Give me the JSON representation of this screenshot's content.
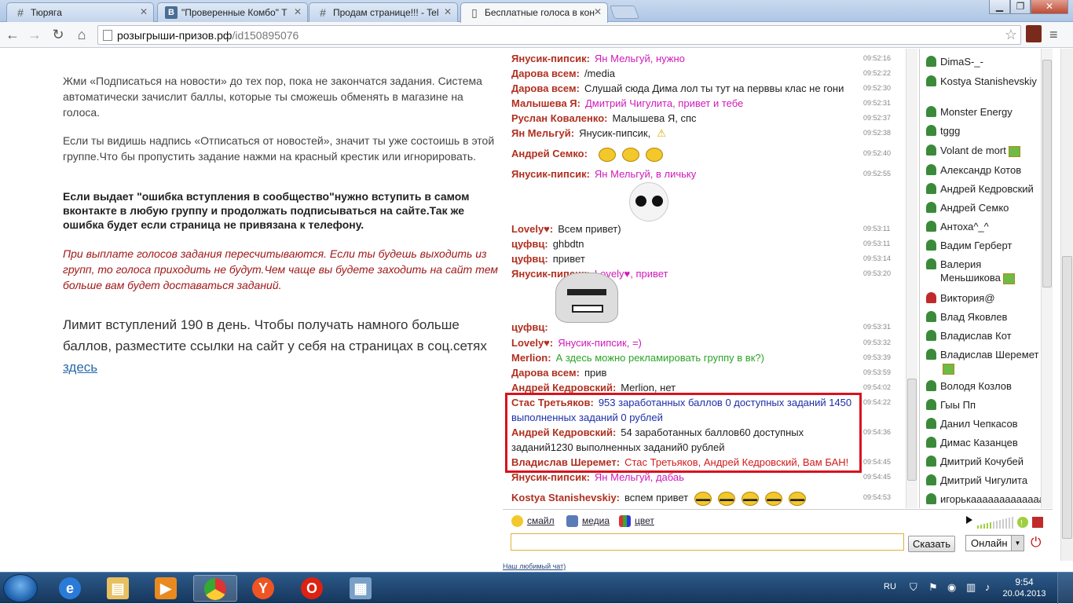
{
  "browser": {
    "tabs": [
      {
        "icon": "#",
        "title": "Тюрягa"
      },
      {
        "icon": "B",
        "title": "\"Проверенные Комбо\" Т"
      },
      {
        "icon": "#",
        "title": "Продам страницe!!! - Tel"
      },
      {
        "icon": "doc",
        "title": "Бесплатные голоса в кон"
      }
    ],
    "url_host": "розыгрыши-призов.рф",
    "url_path": "/id150895076"
  },
  "left": {
    "p1": "Жми «Подписаться на новости» до тех пор, пока не закончатся задания. Система автоматически зачислит баллы, которые ты сможешь обменять в магазине на голоса.",
    "p2": "Если ты видишь надпись «Отписаться от новостей», значит ты уже состоишь в этой группе.Что бы пропустить задание нажми на красный крестик или игнорировать.",
    "p3": "Если выдает \"ошибка вступления в сообщество\"нужно вступить в самом вконтакте в любую группу и продолжать подписываться на сайте.Так же ошибка будет если страница не привязана к телефону.",
    "p4": "При выплате голосов задания пересчитываются. Если ты будешь выходить из групп, то голоса приходить не будут.Чем чаще вы будете заходить на сайт тем больше вам будет доставаться заданий.",
    "p5_text": "Лимит вступлений 190 в день. Чтобы получать намного больше баллов, разместите ссылки на сайт у себя на страницах в соц.сетях ",
    "p5_link": "здесь"
  },
  "chat": {
    "messages": [
      {
        "nick": "Янусик-пипсик:",
        "text": "Ян Мельгуй, нужно",
        "color": "pink",
        "time": "09:52:16"
      },
      {
        "nick": "Дарова всем:",
        "text": "/media",
        "color": "",
        "time": "09:52:22"
      },
      {
        "nick": "Дарова всем:",
        "text": "Слушай сюда Дима лол ты тут на перввы клас не гони",
        "color": "",
        "time": "09:52:30"
      },
      {
        "nick": "Малышева Я:",
        "text": "Дмитрий Чигулита, привет и тебе",
        "color": "pink",
        "time": "09:52:31"
      },
      {
        "nick": "Руслан Коваленко:",
        "text": "Малышева Я, спс",
        "color": "",
        "time": "09:52:37"
      },
      {
        "nick": "Ян Мельгуй:",
        "text": "Янусик-пипсик,",
        "color": "",
        "time": "09:52:38"
      },
      {
        "nick": "Андрей Семко:",
        "text": "",
        "color": "",
        "time": "09:52:40"
      },
      {
        "nick": "Янусик-пипсик:",
        "text": "Ян Мельгуй, в личьку",
        "color": "pink",
        "time": "09:52:55"
      },
      {
        "nick": "Lovely♥:",
        "text": "Всем привет)",
        "color": "",
        "time": "09:53:11"
      },
      {
        "nick": "цуфвц:",
        "text": "ghbdtn",
        "color": "",
        "time": "09:53:11"
      },
      {
        "nick": "цуфвц:",
        "text": "привет",
        "color": "",
        "time": "09:53:14"
      },
      {
        "nick": "Янусик-пипсик:",
        "text": "Lovely♥, привет",
        "color": "pink",
        "time": "09:53:20"
      },
      {
        "nick": "цуфвц:",
        "text": "",
        "color": "",
        "time": "09:53:31"
      },
      {
        "nick": "Lovely♥:",
        "text": "Янусик-пипсик, =)",
        "color": "pink",
        "time": "09:53:32"
      },
      {
        "nick": "Merlion:",
        "text": "А здесь можно рекламировать группу в вк?)",
        "color": "green",
        "time": "09:53:39"
      },
      {
        "nick": "Дарова всем:",
        "text": "прив",
        "color": "",
        "time": "09:53:59"
      },
      {
        "nick": "Андрей Кедровский:",
        "text": "Merlion, нет",
        "color": "",
        "time": "09:54:02"
      },
      {
        "nick": "Стас Третьяков:",
        "text": "953 заработанных баллов 0 доступных заданий 1450 выполненных заданий 0 рублей",
        "color": "blue",
        "time": "09:54:22"
      },
      {
        "nick": "Андрей Кедровский:",
        "text": "54 заработанных баллов60 доступных заданий1230 выполненных заданий0 рублей",
        "color": "",
        "time": "09:54:36"
      },
      {
        "nick": "Владислав Шеремет:",
        "text": "Стас Третьяков, Андрей Кедровский, Вам БАН!",
        "color": "red",
        "time": "09:54:45"
      },
      {
        "nick": "Янусик-пипсик:",
        "text": "Ян Мельгуй, дабаь",
        "color": "pink",
        "time": "09:54:45"
      },
      {
        "nick": "Kostya Stanishevskiy:",
        "text": "вспем привет",
        "color": "",
        "time": "09:54:53"
      }
    ],
    "tools": {
      "smile": "смайл",
      "media": "медиа",
      "color": "цвет"
    },
    "send_label": "Сказать",
    "status_value": "Онлайн",
    "footer": "Наш любимый чат)"
  },
  "users": [
    {
      "name": "DimaS-_-",
      "icon": "green",
      "gift": false
    },
    {
      "name": "Kostya Stanishevskiy",
      "icon": "green",
      "gift": false
    },
    {
      "name": "Monster Energy",
      "icon": "green",
      "gift": false
    },
    {
      "name": "tggg",
      "icon": "green",
      "gift": false
    },
    {
      "name": "Volant de mort",
      "icon": "green",
      "gift": true
    },
    {
      "name": "Александр Котов",
      "icon": "green",
      "gift": false
    },
    {
      "name": "Андрей Кедровский",
      "icon": "green",
      "gift": false
    },
    {
      "name": "Андрей Семко",
      "icon": "green",
      "gift": false
    },
    {
      "name": "Антоха^_^",
      "icon": "green",
      "gift": false
    },
    {
      "name": "Вадим Герберт",
      "icon": "green",
      "gift": false
    },
    {
      "name": "Валерия Меньшикова",
      "icon": "green",
      "gift": true
    },
    {
      "name": "Виктория@",
      "icon": "red",
      "gift": false
    },
    {
      "name": "Влад Яковлев",
      "icon": "green",
      "gift": false
    },
    {
      "name": "Владислав Кот",
      "icon": "green",
      "gift": false
    },
    {
      "name": "Владислав Шеремет",
      "icon": "green",
      "gift": true
    },
    {
      "name": "Володя Козлов",
      "icon": "green",
      "gift": false
    },
    {
      "name": "Гыы Пп",
      "icon": "green",
      "gift": false
    },
    {
      "name": "Данил Чепкасов",
      "icon": "green",
      "gift": false
    },
    {
      "name": "Димас Казанцев",
      "icon": "green",
      "gift": false
    },
    {
      "name": "Дмитрий Кочубей",
      "icon": "green",
      "gift": false
    },
    {
      "name": "Дмитрий Чигулита",
      "icon": "green",
      "gift": false
    },
    {
      "name": "игорькааааааааааааа",
      "icon": "green",
      "gift": false
    }
  ],
  "taskbar": {
    "lang": "RU",
    "time": "9:54",
    "date": "20.04.2013"
  }
}
